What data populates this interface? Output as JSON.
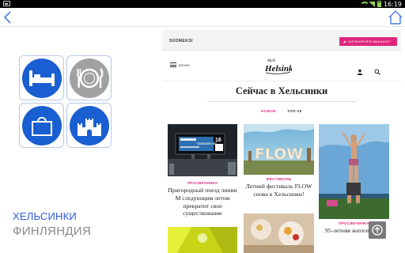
{
  "status_bar": {
    "time": "16:19"
  },
  "left_panel": {
    "categories": [
      {
        "icon": "bed-icon",
        "color": "#1a5fd1"
      },
      {
        "icon": "dining-icon",
        "color": "#a1a1a1"
      },
      {
        "icon": "shopping-bag-icon",
        "color": "#1a5fd1"
      },
      {
        "icon": "castle-icon",
        "color": "#1a5fd1"
      }
    ],
    "city": "ХЕЛЬСИНКИ",
    "country": "ФИНЛЯНДИЯ"
  },
  "website": {
    "language_link": "SUOMEKSI",
    "plan_button": "ЗАПЛАНИРУЙТЕ ВАШ ВИЗИТ",
    "menu_label": "МЕНЮ",
    "logo_top": "MyH",
    "logo_text": "Helsinki",
    "headline": "Сейчас в Хельсинки",
    "tabs": [
      {
        "label": "НОВОЕ",
        "active": true
      },
      {
        "label": "ТОП-20",
        "active": false
      }
    ],
    "cards": [
      {
        "category": "ПРОСВЕЧИНКА",
        "title": "Пригородный поезд линии M следующим летом прекратит свое существование",
        "screen_text": "Vantaankoski",
        "screen_number": "16"
      },
      {
        "category": "ФЕСТИВАЛЬ",
        "title": "Летний фестиваль FLOW снова в Хельсинки!",
        "image_text": "FLOW"
      },
      {
        "category": "ПРОСВЕЧИНКА",
        "title": "95-летняя жительница"
      }
    ]
  },
  "colors": {
    "accent_pink": "#e0267c",
    "icon_blue": "#1a5fd1",
    "label_blue": "#2a5bd8"
  }
}
